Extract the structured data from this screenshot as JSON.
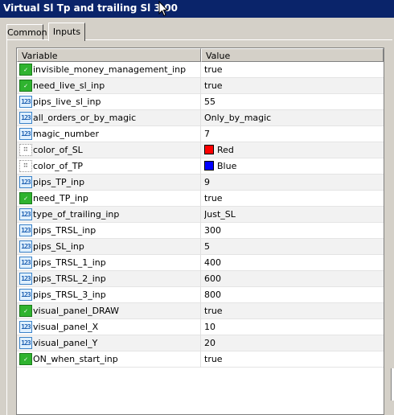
{
  "window": {
    "title": "Virtual Sl Tp and trailing Sl 3.00"
  },
  "tabs": [
    {
      "label": "Common"
    },
    {
      "label": "Inputs"
    }
  ],
  "table": {
    "columns": [
      "Variable",
      "Value"
    ],
    "rows": [
      {
        "variable": "invisible_money_management_inp",
        "value": "true",
        "type": "bool-icon"
      },
      {
        "variable": "need_live_sl_inp",
        "value": "true",
        "type": "bool-icon"
      },
      {
        "variable": "pips_live_sl_inp",
        "value": "55",
        "type": "number-icon"
      },
      {
        "variable": "all_orders_or_by_magic",
        "value": "Only_by_magic",
        "type": "number-icon"
      },
      {
        "variable": "magic_number",
        "value": "7",
        "type": "number-icon"
      },
      {
        "variable": "color_of_SL",
        "value": "Red",
        "type": "color-icon",
        "swatch": "#ff0000"
      },
      {
        "variable": "color_of_TP",
        "value": "Blue",
        "type": "color-icon",
        "swatch": "#0000ff"
      },
      {
        "variable": "pips_TP_inp",
        "value": "9",
        "type": "number-icon"
      },
      {
        "variable": "need_TP_inp",
        "value": "true",
        "type": "bool-icon"
      },
      {
        "variable": "type_of_trailing_inp",
        "value": "Just_SL",
        "type": "number-icon"
      },
      {
        "variable": "pips_TRSL_inp",
        "value": "300",
        "type": "number-icon"
      },
      {
        "variable": "pips_SL_inp",
        "value": "5",
        "type": "number-icon"
      },
      {
        "variable": "pips_TRSL_1_inp",
        "value": "400",
        "type": "number-icon"
      },
      {
        "variable": "pips_TRSL_2_inp",
        "value": "600",
        "type": "number-icon"
      },
      {
        "variable": "pips_TRSL_3_inp",
        "value": "800",
        "type": "number-icon"
      },
      {
        "variable": "visual_panel_DRAW",
        "value": "true",
        "type": "bool-icon"
      },
      {
        "variable": "visual_panel_X",
        "value": "10",
        "type": "number-icon"
      },
      {
        "variable": "visual_panel_Y",
        "value": "20",
        "type": "number-icon"
      },
      {
        "variable": "ON_when_start_inp",
        "value": "true",
        "type": "bool-icon"
      }
    ]
  },
  "colors": {
    "titlebar": "#0a246a",
    "dialog": "#d4d0c8",
    "bool_icon": "#2fb32f",
    "number_icon": "#3a82c8"
  }
}
